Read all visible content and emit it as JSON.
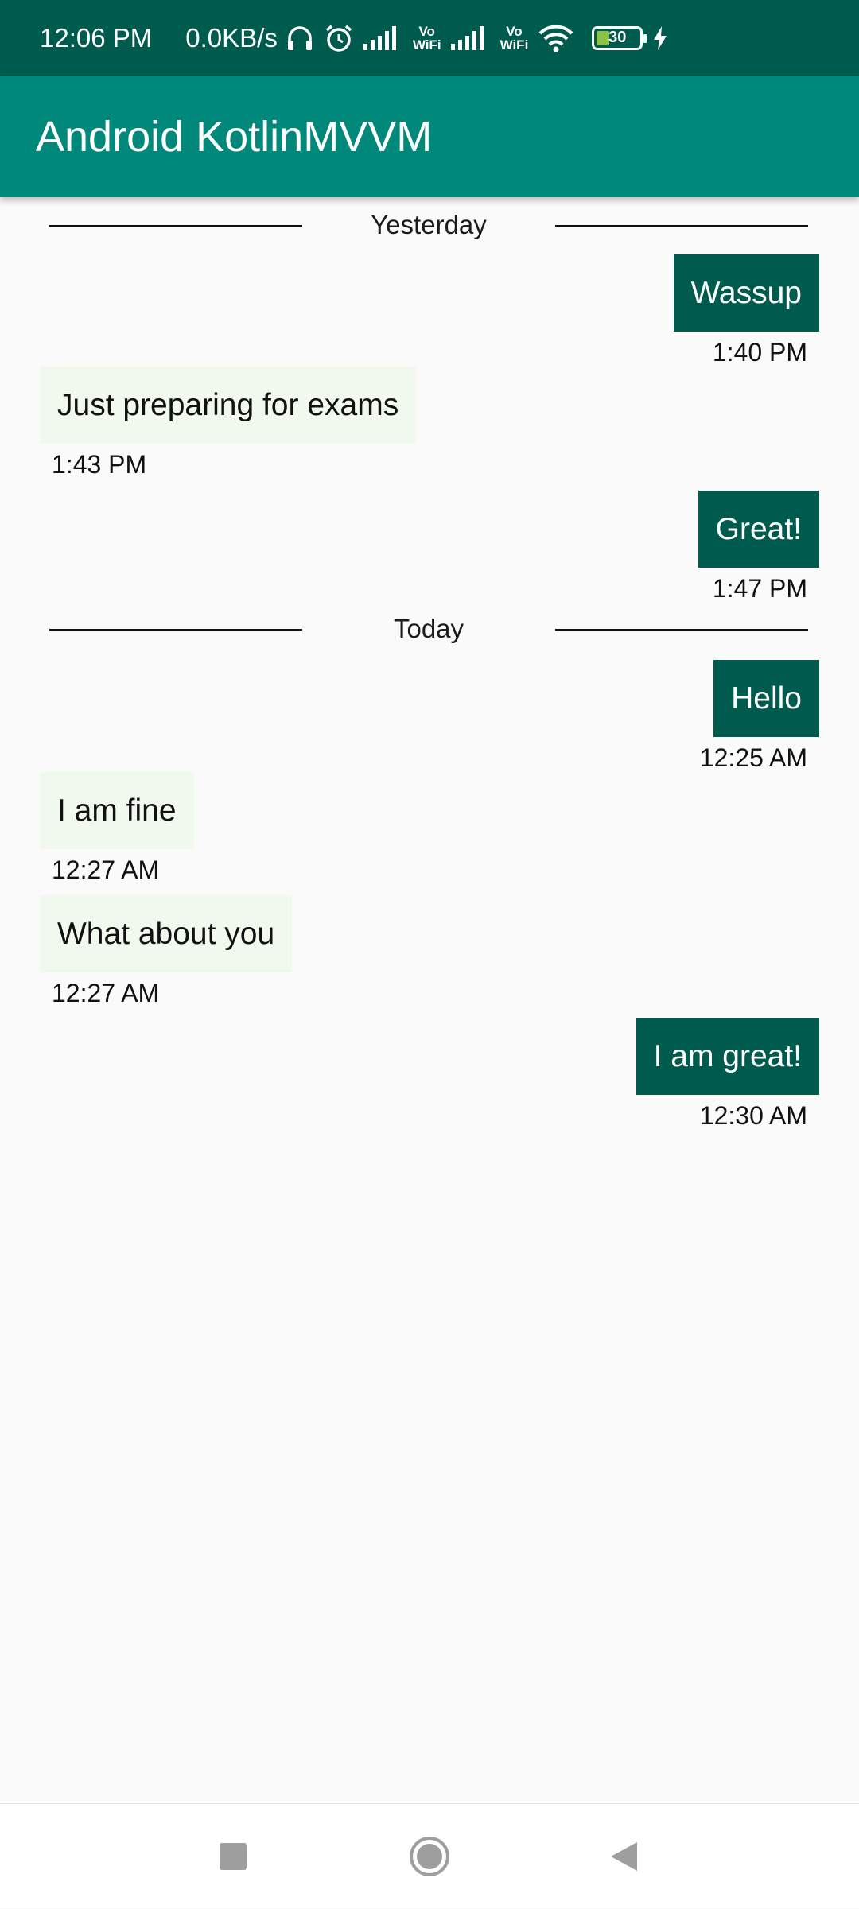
{
  "status_bar": {
    "time": "12:06 PM",
    "network_speed": "0.0KB/s",
    "vowifi_1_top": "Vo",
    "vowifi_1_bottom": "WiFi",
    "vowifi_2_top": "Vo",
    "vowifi_2_bottom": "WiFi",
    "battery_level": "30",
    "icons": [
      "headphones-icon",
      "alarm-icon",
      "signal-icon",
      "signal-icon",
      "wifi-icon",
      "battery-icon",
      "charging-icon"
    ]
  },
  "app_bar": {
    "title": "Android KotlinMVVM"
  },
  "colors": {
    "status_bar": "#005b4f",
    "app_bar": "#00897b",
    "sent_bubble": "#005b4f",
    "received_bubble": "#f1f8ee",
    "background": "#fafafa"
  },
  "chat": {
    "dividers": [
      {
        "label": "Yesterday"
      },
      {
        "label": "Today"
      }
    ],
    "messages": [
      {
        "direction": "sent",
        "text": "Wassup",
        "time": "1:40 PM"
      },
      {
        "direction": "received",
        "text": "Just preparing for exams",
        "time": "1:43 PM"
      },
      {
        "direction": "sent",
        "text": "Great!",
        "time": "1:47 PM"
      },
      {
        "direction": "sent",
        "text": "Hello",
        "time": "12:25 AM"
      },
      {
        "direction": "received",
        "text": "I am fine",
        "time": "12:27 AM"
      },
      {
        "direction": "received",
        "text": "What about you",
        "time": "12:27 AM"
      },
      {
        "direction": "sent",
        "text": "I am great!",
        "time": "12:30 AM"
      }
    ]
  },
  "nav_bar": {
    "icons": [
      "recent-apps-icon",
      "home-icon",
      "back-icon"
    ]
  }
}
